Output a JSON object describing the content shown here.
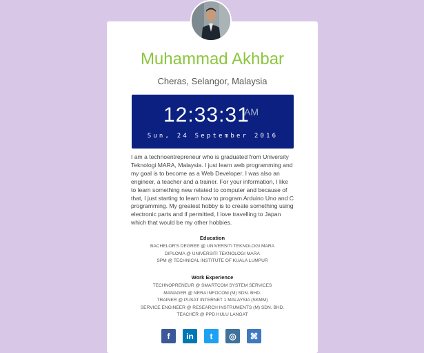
{
  "profile": {
    "name": "Muhammad Akhbar",
    "location": "Cheras, Selangor, Malaysia"
  },
  "clock": {
    "time": "12:33:31",
    "ampm": "AM",
    "date": "Sun, 24 September 2016"
  },
  "bio": "I am a technoentrepreneur who is graduated from University Teknologi MARA, Malaysia. I just learn web programming and my goal is to become as a Web Developer. I was also an engineer, a teacher and a trainer. For your information, I like to learn something new related to computer and because of that, I just starting to learn how to program Arduino Uno and C programming. My greatest hobby is to create something using electronic parts and if permitted, I love travelling to Japan which that would be my other hobbies.",
  "education": {
    "title": "Education",
    "items": [
      "BACHELOR'S DEGREE @ UNIVERSITI TEKNOLOGI MARA",
      "DIPLOMA @ UNIVERSITI TEKNOLOGI MARA",
      "SPM @ TECHNICAL INSTITUTE OF KUALA LUMPUR"
    ]
  },
  "work": {
    "title": "Work Experience",
    "items": [
      "TECHNOPRENEUR @ SMARTCOM SYSTEM SERVICES",
      "MANAGER @ NERA INFOCOM (M) SDN. BHD.",
      "TRAINER @ PUSAT INTERNET 1 MALAYSIA (SKMM)",
      "SERVICE ENGINEER @ RESEARCH INSTRUMENTS (M) SDN. BHD.",
      "TEACHER @ PPD HULU LANGAT"
    ]
  },
  "social": [
    {
      "icon": "facebook-icon",
      "glyph": "f",
      "color": "#3b5998"
    },
    {
      "icon": "linkedin-icon",
      "glyph": "in",
      "color": "#0077b5"
    },
    {
      "icon": "twitter-icon",
      "glyph": "t",
      "color": "#1da1f2"
    },
    {
      "icon": "instagram-icon",
      "glyph": "◎",
      "color": "#3f729b"
    },
    {
      "icon": "github-icon",
      "glyph": "⌘",
      "color": "#4078c0"
    }
  ],
  "colors": {
    "background": "#d9c7e8",
    "name": "#8cc63f",
    "clock_bg": "#0b2080"
  }
}
